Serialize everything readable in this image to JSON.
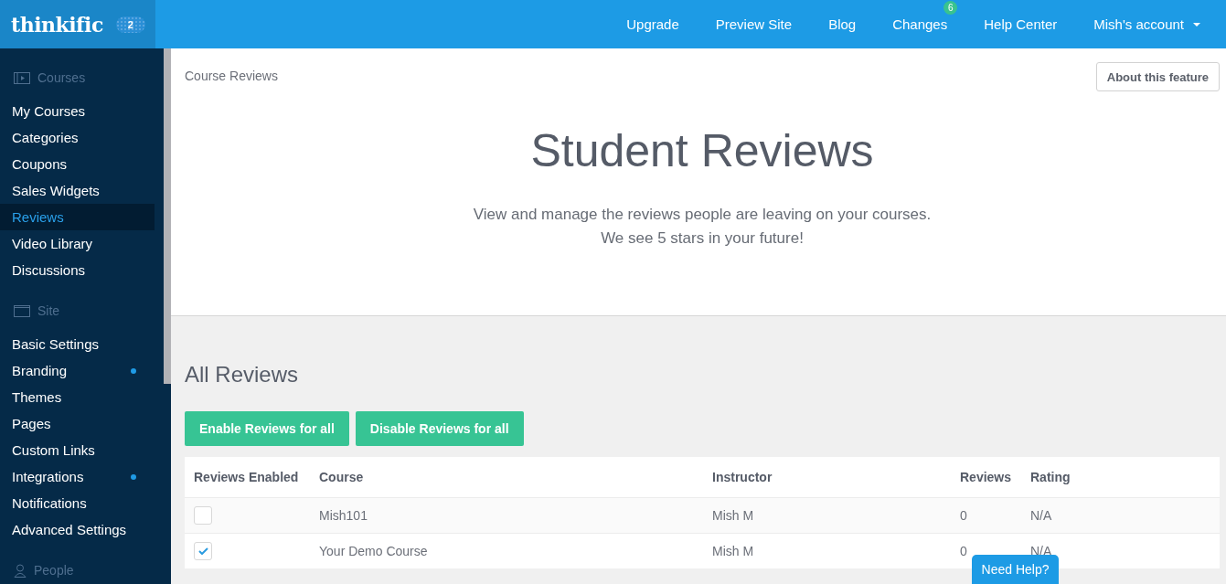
{
  "logo": {
    "text": "thinkific",
    "badge": "2"
  },
  "nav": [
    {
      "label": "Upgrade"
    },
    {
      "label": "Preview Site"
    },
    {
      "label": "Blog"
    },
    {
      "label": "Changes",
      "badge": "6"
    },
    {
      "label": "Help Center"
    },
    {
      "label": "Mish's account",
      "dropdown": true
    }
  ],
  "sidebar": {
    "sections": [
      {
        "title": "Courses",
        "items": [
          {
            "label": "My Courses",
            "selected": false,
            "dot": false
          },
          {
            "label": "Categories",
            "selected": false,
            "dot": false
          },
          {
            "label": "Coupons",
            "selected": false,
            "dot": false
          },
          {
            "label": "Sales Widgets",
            "selected": false,
            "dot": false
          },
          {
            "label": "Reviews",
            "selected": true,
            "dot": false
          },
          {
            "label": "Video Library",
            "selected": false,
            "dot": false
          },
          {
            "label": "Discussions",
            "selected": false,
            "dot": false
          }
        ]
      },
      {
        "title": "Site",
        "items": [
          {
            "label": "Basic Settings",
            "selected": false,
            "dot": false
          },
          {
            "label": "Branding",
            "selected": false,
            "dot": true
          },
          {
            "label": "Themes",
            "selected": false,
            "dot": false
          },
          {
            "label": "Pages",
            "selected": false,
            "dot": false
          },
          {
            "label": "Custom Links",
            "selected": false,
            "dot": false
          },
          {
            "label": "Integrations",
            "selected": false,
            "dot": true
          },
          {
            "label": "Notifications",
            "selected": false,
            "dot": false
          },
          {
            "label": "Advanced Settings",
            "selected": false,
            "dot": false
          }
        ]
      },
      {
        "title": "People"
      }
    ]
  },
  "breadcrumb": "Course Reviews",
  "about_button": "About this feature",
  "hero": {
    "title": "Student Reviews",
    "lines": [
      "View and manage the reviews people are leaving on your courses.",
      "We see 5 stars in your future!"
    ]
  },
  "section_title": "All Reviews",
  "buttons": [
    "Enable Reviews for all",
    "Disable Reviews for all"
  ],
  "table": {
    "columns": [
      "Reviews Enabled",
      "Course",
      "Instructor",
      "Reviews",
      "Rating"
    ],
    "rows": [
      {
        "checked": false,
        "course": "Mish101",
        "instructor": "Mish M",
        "reviews": "0",
        "rating": "N/A"
      },
      {
        "checked": true,
        "course": "Your Demo Course",
        "instructor": "Mish M",
        "reviews": "0",
        "rating": "N/A"
      }
    ]
  },
  "help_button": "Need Help?"
}
